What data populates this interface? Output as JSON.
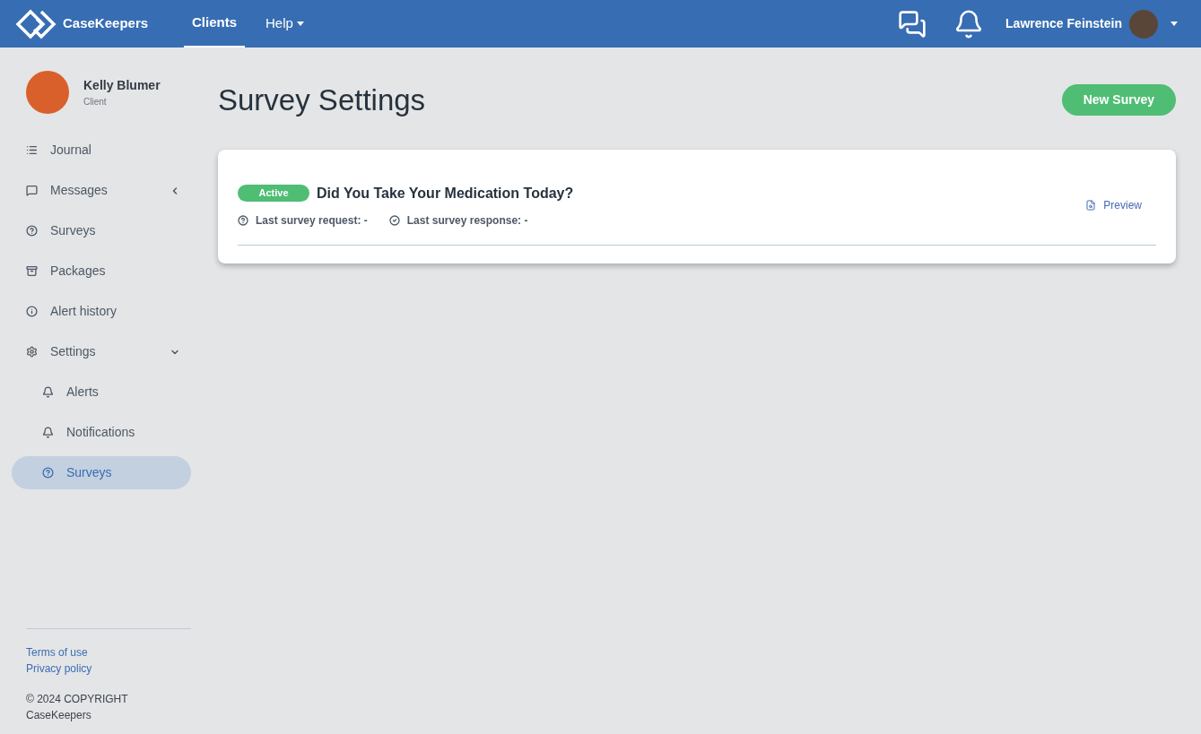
{
  "header": {
    "brand": "CaseKeepers",
    "nav": [
      {
        "label": "Clients",
        "selected": true,
        "dropdown": false
      },
      {
        "label": "Help",
        "selected": false,
        "dropdown": true
      }
    ],
    "user": "Lawrence Feinstein"
  },
  "sidebar": {
    "profile": {
      "name": "Kelly Blumer",
      "role": "Client"
    },
    "items": [
      {
        "label": "Journal",
        "selected": false
      },
      {
        "label": "Messages",
        "selected": false,
        "expanded": false
      },
      {
        "label": "Surveys",
        "selected": false
      },
      {
        "label": "Packages",
        "selected": false
      },
      {
        "label": "Alert history",
        "selected": false
      },
      {
        "label": "Settings",
        "selected": false,
        "expanded": true,
        "children": [
          {
            "label": "Alerts",
            "selected": false
          },
          {
            "label": "Notifications",
            "selected": false
          },
          {
            "label": "Surveys",
            "selected": true
          }
        ]
      }
    ],
    "footer_links": [
      "Terms of use",
      "Privacy policy"
    ],
    "copyright": [
      "© 2024 COPYRIGHT",
      "CaseKeepers"
    ]
  },
  "page": {
    "title": "Survey Settings",
    "new_button": "New Survey",
    "surveys": [
      {
        "status": "Active",
        "active": true,
        "title": "Did You Take Your Medication Today?",
        "request": "Last survey request: -",
        "response": "Last survey response: -",
        "preview": "Preview"
      }
    ]
  }
}
